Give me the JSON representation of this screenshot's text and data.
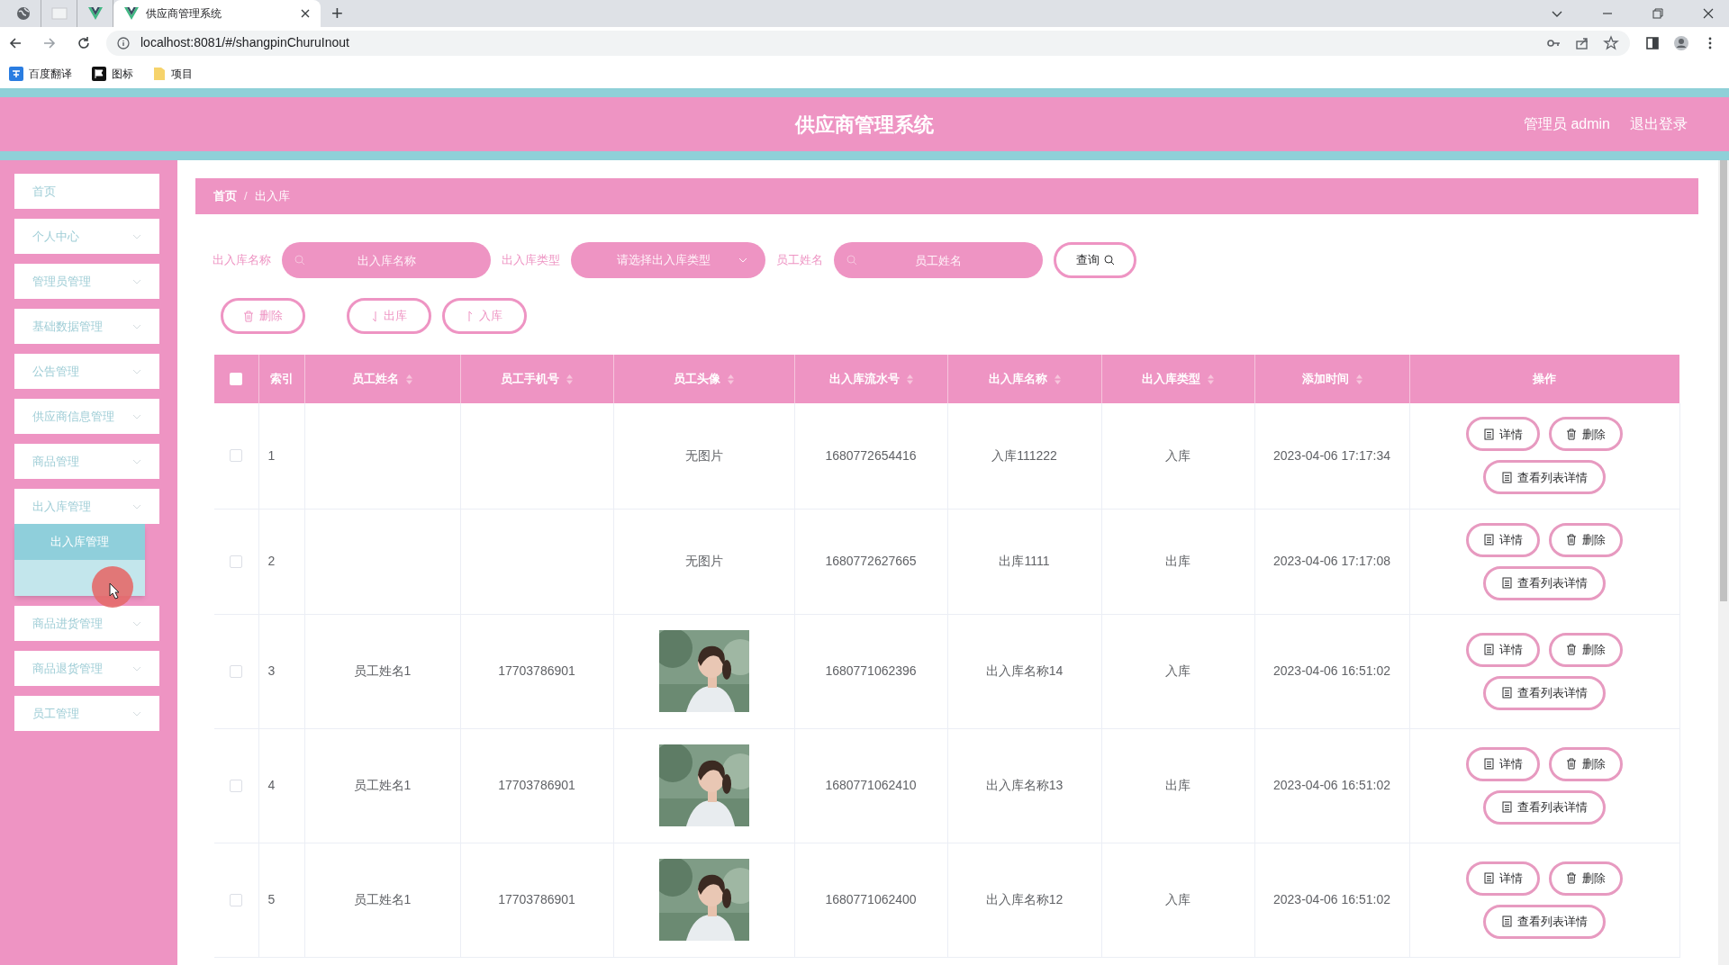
{
  "browser": {
    "tabs": [
      {
        "kind": "globe",
        "selected": false
      },
      {
        "kind": "blank",
        "selected": false
      },
      {
        "kind": "vue",
        "selected": false
      },
      {
        "kind": "vue",
        "title": "供应商管理系统",
        "selected": true
      }
    ],
    "new_tab": "+",
    "url": "localhost:8081/#/shangpinChuruInout",
    "bookmarks": [
      {
        "kind": "translate",
        "label": "百度翻译"
      },
      {
        "kind": "flag",
        "label": "图标"
      },
      {
        "kind": "folder",
        "label": "项目"
      }
    ]
  },
  "header": {
    "title": "供应商管理系统",
    "user": "管理员 admin",
    "logout": "退出登录"
  },
  "sidebar": {
    "items": [
      {
        "label": "首页",
        "expandable": false
      },
      {
        "label": "个人中心",
        "expandable": true
      },
      {
        "label": "管理员管理",
        "expandable": true
      },
      {
        "label": "基础数据管理",
        "expandable": true
      },
      {
        "label": "公告管理",
        "expandable": true
      },
      {
        "label": "供应商信息管理",
        "expandable": true
      },
      {
        "label": "商品管理",
        "expandable": true
      },
      {
        "label": "出入库管理",
        "expandable": true,
        "expanded": true,
        "children": [
          {
            "label": "出入库管理",
            "selected": true
          },
          {
            "selected": false
          }
        ]
      },
      {
        "label": "商品进货管理",
        "expandable": true
      },
      {
        "label": "商品退货管理",
        "expandable": true
      },
      {
        "label": "员工管理",
        "expandable": true
      }
    ]
  },
  "breadcrumb": {
    "items": [
      "首页",
      "出入库"
    ],
    "separator": "/"
  },
  "filters": [
    {
      "kind": "text",
      "label": "出入库名称",
      "placeholder": "出入库名称"
    },
    {
      "kind": "select",
      "label": "出入库类型",
      "placeholder": "请选择出入库类型"
    },
    {
      "kind": "text",
      "label": "员工姓名",
      "placeholder": "员工姓名"
    }
  ],
  "search_button": "查询",
  "actions": [
    {
      "label": "删除"
    },
    {
      "label": "出库"
    },
    {
      "label": "入库"
    }
  ],
  "table": {
    "select_all": false,
    "columns": [
      {
        "label": "索引",
        "sortable": false
      },
      {
        "label": "员工姓名",
        "sortable": true
      },
      {
        "label": "员工手机号",
        "sortable": true
      },
      {
        "label": "员工头像",
        "sortable": true
      },
      {
        "label": "出入库流水号",
        "sortable": true
      },
      {
        "label": "出入库名称",
        "sortable": true
      },
      {
        "label": "出入库类型",
        "sortable": true
      },
      {
        "label": "添加时间",
        "sortable": true
      },
      {
        "label": "操作",
        "sortable": false
      }
    ],
    "rows": [
      {
        "checked": false,
        "index": "1",
        "name": "",
        "phone": "",
        "avatar": {
          "kind": "none",
          "text": "无图片"
        },
        "serial": "1680772654416",
        "title": "入库111222",
        "type": "入库",
        "time": "2023-04-06 17:17:34",
        "actions": [
          "详情",
          "删除",
          "查看列表详情"
        ]
      },
      {
        "checked": false,
        "index": "2",
        "name": "",
        "phone": "",
        "avatar": {
          "kind": "none",
          "text": "无图片"
        },
        "serial": "1680772627665",
        "title": "出库1111",
        "type": "出库",
        "time": "2023-04-06 17:17:08",
        "actions": [
          "详情",
          "删除",
          "查看列表详情"
        ]
      },
      {
        "checked": false,
        "index": "3",
        "name": "员工姓名1",
        "phone": "17703786901",
        "avatar": {
          "kind": "picture"
        },
        "serial": "1680771062396",
        "title": "出入库名称14",
        "type": "入库",
        "time": "2023-04-06 16:51:02",
        "actions": [
          "详情",
          "删除",
          "查看列表详情"
        ]
      },
      {
        "checked": false,
        "index": "4",
        "name": "员工姓名1",
        "phone": "17703786901",
        "avatar": {
          "kind": "picture"
        },
        "serial": "1680771062410",
        "title": "出入库名称13",
        "type": "出库",
        "time": "2023-04-06 16:51:02",
        "actions": [
          "详情",
          "删除",
          "查看列表详情"
        ]
      },
      {
        "checked": false,
        "index": "5",
        "name": "员工姓名1",
        "phone": "17703786901",
        "avatar": {
          "kind": "picture"
        },
        "serial": "1680771062400",
        "title": "出入库名称12",
        "type": "入库",
        "time": "2023-04-06 16:51:02",
        "actions": [
          "详情",
          "删除",
          "查看列表详情"
        ]
      }
    ]
  }
}
